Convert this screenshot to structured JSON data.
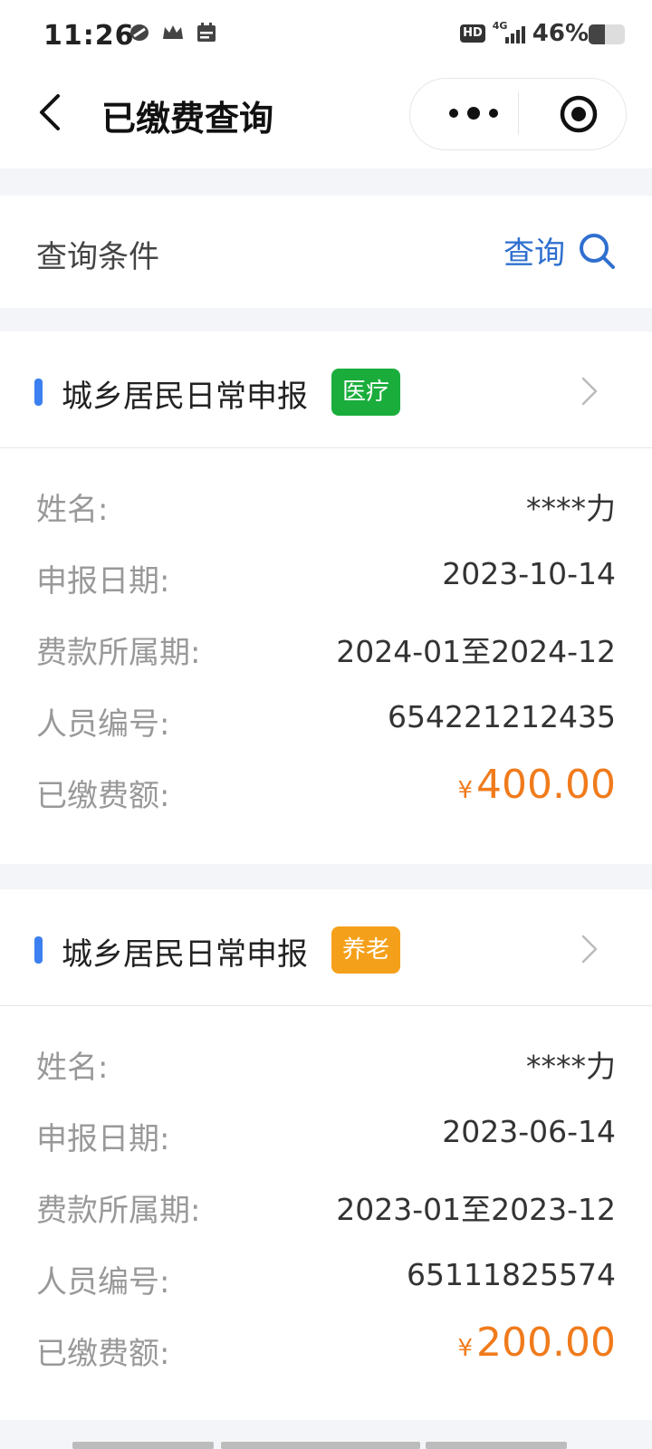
{
  "status_bar": {
    "time": "11:26",
    "hd": "HD",
    "network": "4G",
    "battery": "46%",
    "battery_level": 0.46
  },
  "header": {
    "title": "已缴费查询"
  },
  "query": {
    "label": "查询条件",
    "action": "查询"
  },
  "colors": {
    "accent_blue": "#3c7ff0",
    "link_blue": "#2f6fcf",
    "badge_medical": "#1aad3c",
    "badge_pension": "#f5a01a",
    "amount_orange": "#f07b1c"
  },
  "records": [
    {
      "title": "城乡居民日常申报",
      "badge": "医疗",
      "fields": [
        {
          "label": "姓名:",
          "value": "****力"
        },
        {
          "label": "申报日期:",
          "value": "2023-10-14"
        },
        {
          "label": "费款所属期:",
          "value": "2024-01至2024-12"
        },
        {
          "label": "人员编号:",
          "value": "654221212435"
        }
      ],
      "amount_label": "已缴费额:",
      "currency": "¥",
      "amount": "400.00"
    },
    {
      "title": "城乡居民日常申报",
      "badge": "养老",
      "fields": [
        {
          "label": "姓名:",
          "value": "****力"
        },
        {
          "label": "申报日期:",
          "value": "2023-06-14"
        },
        {
          "label": "费款所属期:",
          "value": "2023-01至2023-12"
        },
        {
          "label": "人员编号:",
          "value": "65111825574"
        }
      ],
      "amount_label": "已缴费额:",
      "currency": "¥",
      "amount": "200.00"
    }
  ]
}
